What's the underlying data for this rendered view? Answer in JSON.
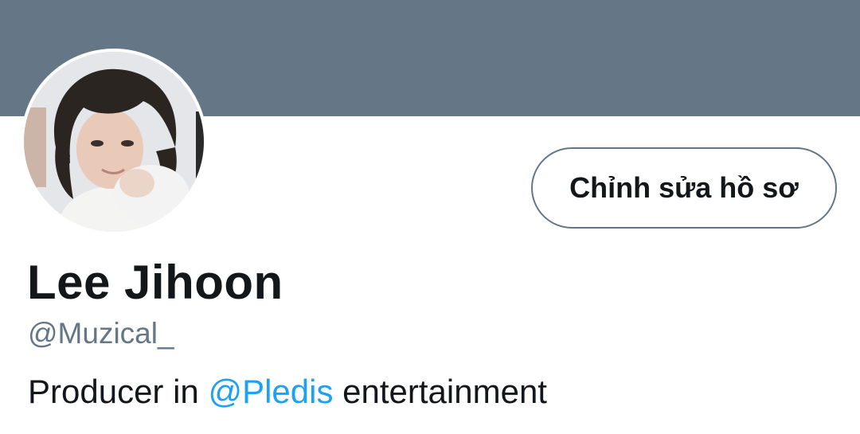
{
  "profile": {
    "banner_color": "#657786",
    "avatar_alt": "profile photo",
    "edit_button_label": "Chỉnh sửa hồ sơ",
    "display_name": "Lee Jihoon",
    "handle": "@Muzical_",
    "bio": {
      "prefix": "Producer in ",
      "mention": "@Pledis",
      "suffix": " entertainment"
    }
  },
  "colors": {
    "text_primary": "#14171a",
    "text_secondary": "#657786",
    "link": "#1da1f2"
  }
}
